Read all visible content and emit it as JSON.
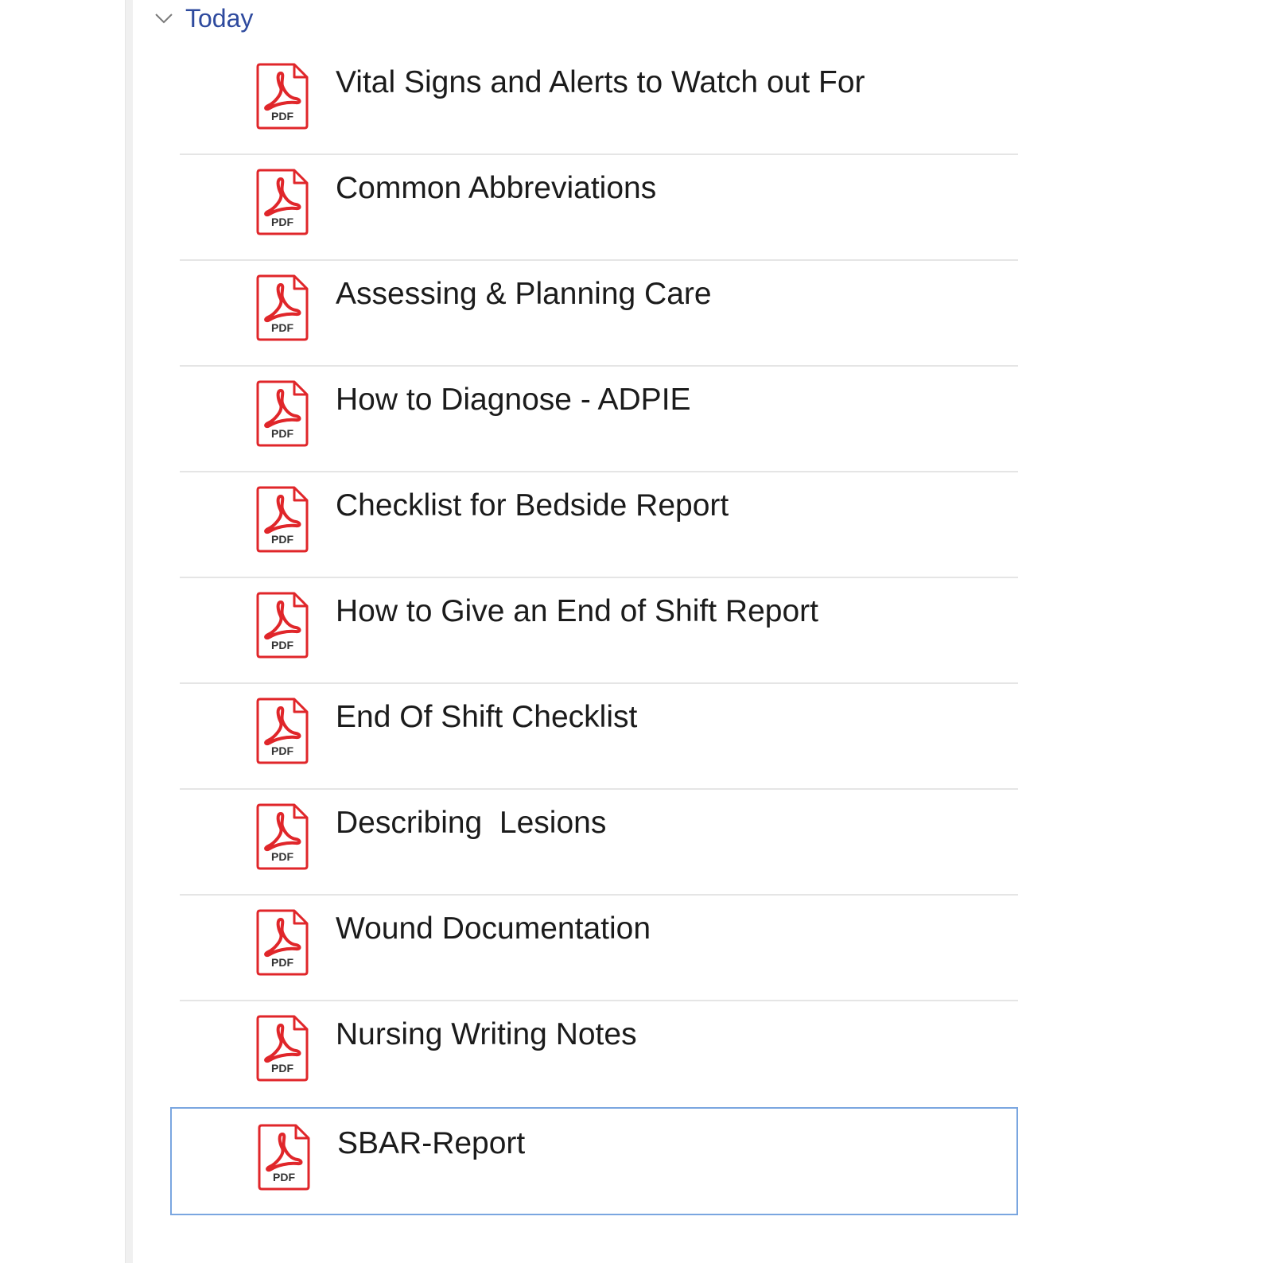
{
  "group": {
    "title": "Today",
    "expanded": true,
    "icon": "chevron-down-icon"
  },
  "colors": {
    "group_title": "#2e4a9e",
    "pdf_red": "#e0262a",
    "selection_border": "#7aa6e0",
    "divider": "#e5e5e5"
  },
  "files": [
    {
      "name": "Vital Signs and Alerts to Watch out For",
      "icon": "pdf-file-icon",
      "icon_label": "PDF"
    },
    {
      "name": "Common Abbreviations",
      "icon": "pdf-file-icon",
      "icon_label": "PDF"
    },
    {
      "name": "Assessing & Planning Care",
      "icon": "pdf-file-icon",
      "icon_label": "PDF"
    },
    {
      "name": "How to Diagnose - ADPIE",
      "icon": "pdf-file-icon",
      "icon_label": "PDF"
    },
    {
      "name": "Checklist for Bedside Report",
      "icon": "pdf-file-icon",
      "icon_label": "PDF"
    },
    {
      "name": "How to Give an End of Shift Report",
      "icon": "pdf-file-icon",
      "icon_label": "PDF"
    },
    {
      "name": "End Of Shift Checklist",
      "icon": "pdf-file-icon",
      "icon_label": "PDF"
    },
    {
      "name": "Describing  Lesions",
      "icon": "pdf-file-icon",
      "icon_label": "PDF"
    },
    {
      "name": "Wound Documentation",
      "icon": "pdf-file-icon",
      "icon_label": "PDF"
    },
    {
      "name": "Nursing Writing Notes",
      "icon": "pdf-file-icon",
      "icon_label": "PDF"
    },
    {
      "name": "SBAR-Report",
      "icon": "pdf-file-icon",
      "icon_label": "PDF",
      "selected": true
    }
  ]
}
